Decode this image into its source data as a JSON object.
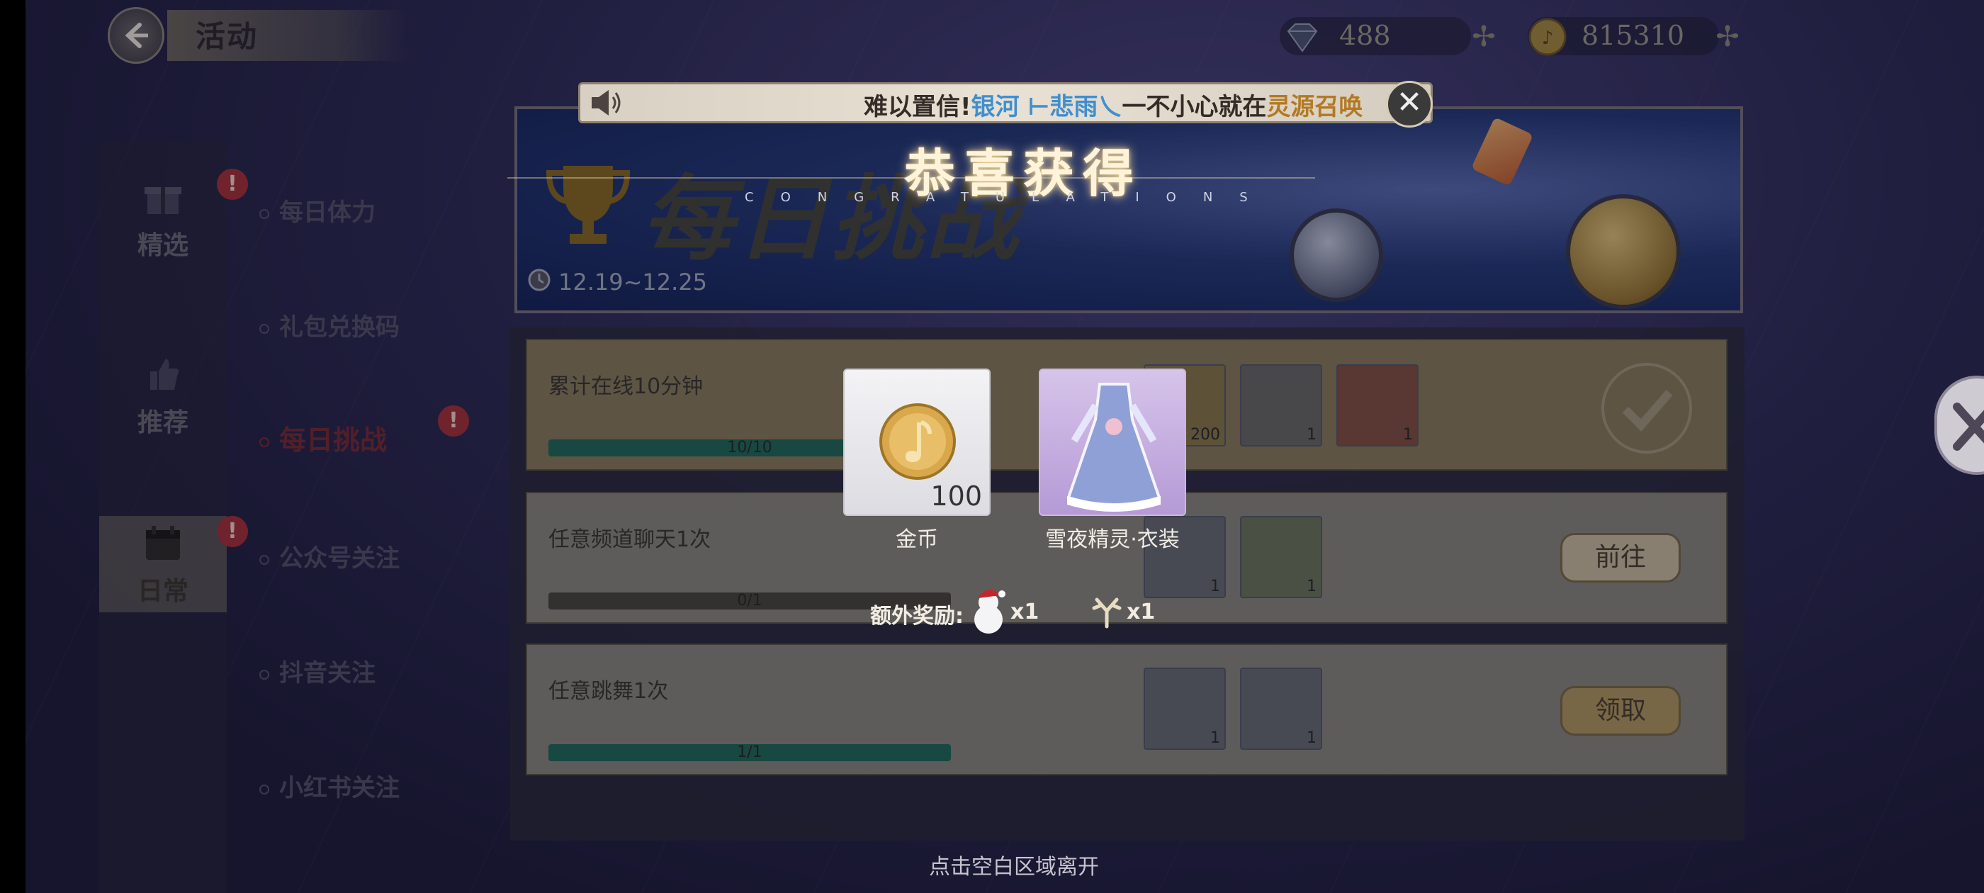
{
  "header": {
    "title": "活动",
    "diamonds": "488",
    "coins": "815310"
  },
  "sidebar": {
    "categories": [
      {
        "label": "精选",
        "badge": "!"
      },
      {
        "label": "推荐",
        "badge": ""
      },
      {
        "label": "日常",
        "badge": "!"
      }
    ],
    "menu": [
      {
        "label": "每日体力"
      },
      {
        "label": "礼包兑换码"
      },
      {
        "label": "每日挑战",
        "badge": "!"
      },
      {
        "label": "公众号关注"
      },
      {
        "label": "抖音关注"
      },
      {
        "label": "小红书关注"
      }
    ]
  },
  "banner": {
    "title": "每日挑战",
    "date": "12.19~12.25"
  },
  "tasks": [
    {
      "title": "累计在线10分钟",
      "progress_text": "10/10",
      "progress": 1.0,
      "items": [
        {
          "count": "200"
        },
        {
          "count": "1"
        },
        {
          "count": "1"
        }
      ],
      "button": ""
    },
    {
      "title": "任意频道聊天1次",
      "progress_text": "0/1",
      "progress": 0.0,
      "items": [
        {
          "count": "1"
        },
        {
          "count": "1"
        }
      ],
      "button": "前往"
    },
    {
      "title": "任意跳舞1次",
      "progress_text": "1/1",
      "progress": 1.0,
      "items": [
        {
          "count": "1"
        },
        {
          "count": "1"
        }
      ],
      "button": "领取"
    }
  ],
  "popup": {
    "notice": {
      "prefix": "难以置信!",
      "name": "银河 ⊢悲雨乀",
      "middle": "一不小心就在",
      "place": "灵源召唤"
    },
    "congrats": "恭喜获得",
    "congrats_sub": "CONGRATULATIONS",
    "rewards": [
      {
        "name": "金币",
        "qty": "100",
        "icon": "gold-coin-icon"
      },
      {
        "name": "雪夜精灵·衣装",
        "qty": "",
        "icon": "snow-dress-icon"
      }
    ],
    "extra_label": "额外奖励:",
    "extra_items": [
      {
        "icon": "snowman-santa-icon",
        "qty": "x1"
      },
      {
        "icon": "antler-icon",
        "qty": "x1"
      }
    ],
    "footer": "点击空白区域离开"
  },
  "colors": {
    "accent_gold": "#c9a659",
    "badge_red": "#a8323a",
    "progress_green": "#1f6b5a"
  }
}
